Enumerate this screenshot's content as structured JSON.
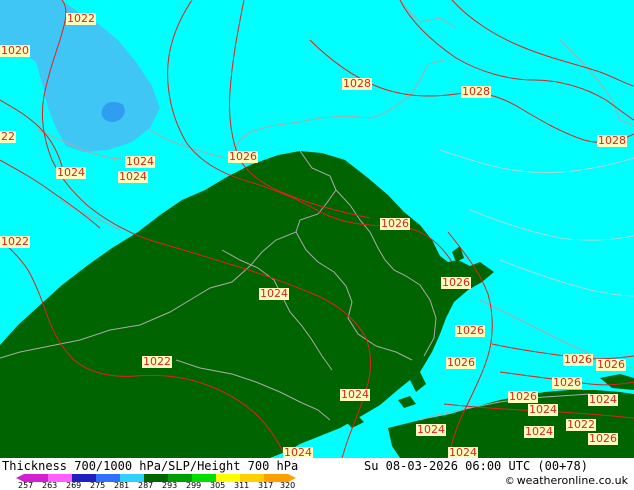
{
  "map": {
    "colors": {
      "background": "#00ffff",
      "land": "#006400",
      "blue_light": "#3fc6f5",
      "blue_mid": "#2f9ef0",
      "contour": "#e0201c",
      "border": "#aaaaaa",
      "label_bg": "#ffffc0"
    },
    "isobar_labels": [
      "1022",
      "1020",
      "22",
      "1028",
      "1028",
      "1028",
      "1026",
      "1024",
      "1024",
      "1024",
      "1026",
      "1022",
      "1026",
      "1024",
      "1026",
      "1026",
      "1022",
      "1024",
      "1026",
      "1026",
      "1026",
      "1026",
      "1024",
      "1024",
      "1024",
      "1022",
      "1024",
      "1026",
      "1024",
      "1024"
    ]
  },
  "footer": {
    "title": "Thickness 700/1000 hPa/SLP/Height 700 hPa",
    "datetime": "Su 08-03-2026 06:00 UTC (00+78)",
    "copyright": "weatheronline.co.uk",
    "copyright_symbol": "©",
    "legend_ticks": [
      "257",
      "263",
      "269",
      "275",
      "281",
      "287",
      "293",
      "299",
      "305",
      "311",
      "317",
      "320"
    ],
    "legend_colors": [
      "#d020d0",
      "#ff60ff",
      "#2020c0",
      "#3070ff",
      "#30d0ff",
      "#006400",
      "#00a000",
      "#00e000",
      "#ffff00",
      "#ffd000",
      "#ffa000"
    ]
  }
}
